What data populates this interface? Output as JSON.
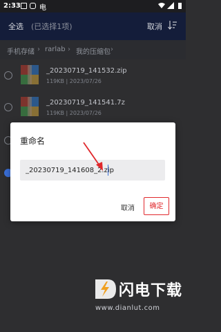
{
  "status_bar": {
    "time": "2:33"
  },
  "app_bar": {
    "select_all": "全选",
    "selected_count": "(已选择1项)",
    "cancel": "取消"
  },
  "breadcrumb": [
    "手机存储",
    "rarlab",
    "我的压缩包"
  ],
  "files": [
    {
      "name": "_20230719_141532.zip",
      "meta": "119KB  |  2023/07/26",
      "checked": false
    },
    {
      "name": "_20230719_141541.7z",
      "meta": "119KB  |  2023/07/26",
      "checked": false
    },
    {
      "name": "",
      "meta": "",
      "checked": false
    },
    {
      "name": "",
      "meta": "",
      "checked": true
    }
  ],
  "dialog": {
    "title": "重命名",
    "input_value": "_20230719_141608_2.zip",
    "cancel": "取消",
    "confirm": "确定"
  },
  "watermark": {
    "url": "www.dianlut.com"
  },
  "colors": {
    "app_bar": "#141d3a",
    "accent": "#3a6fd8",
    "highlight": "#e0282c"
  }
}
